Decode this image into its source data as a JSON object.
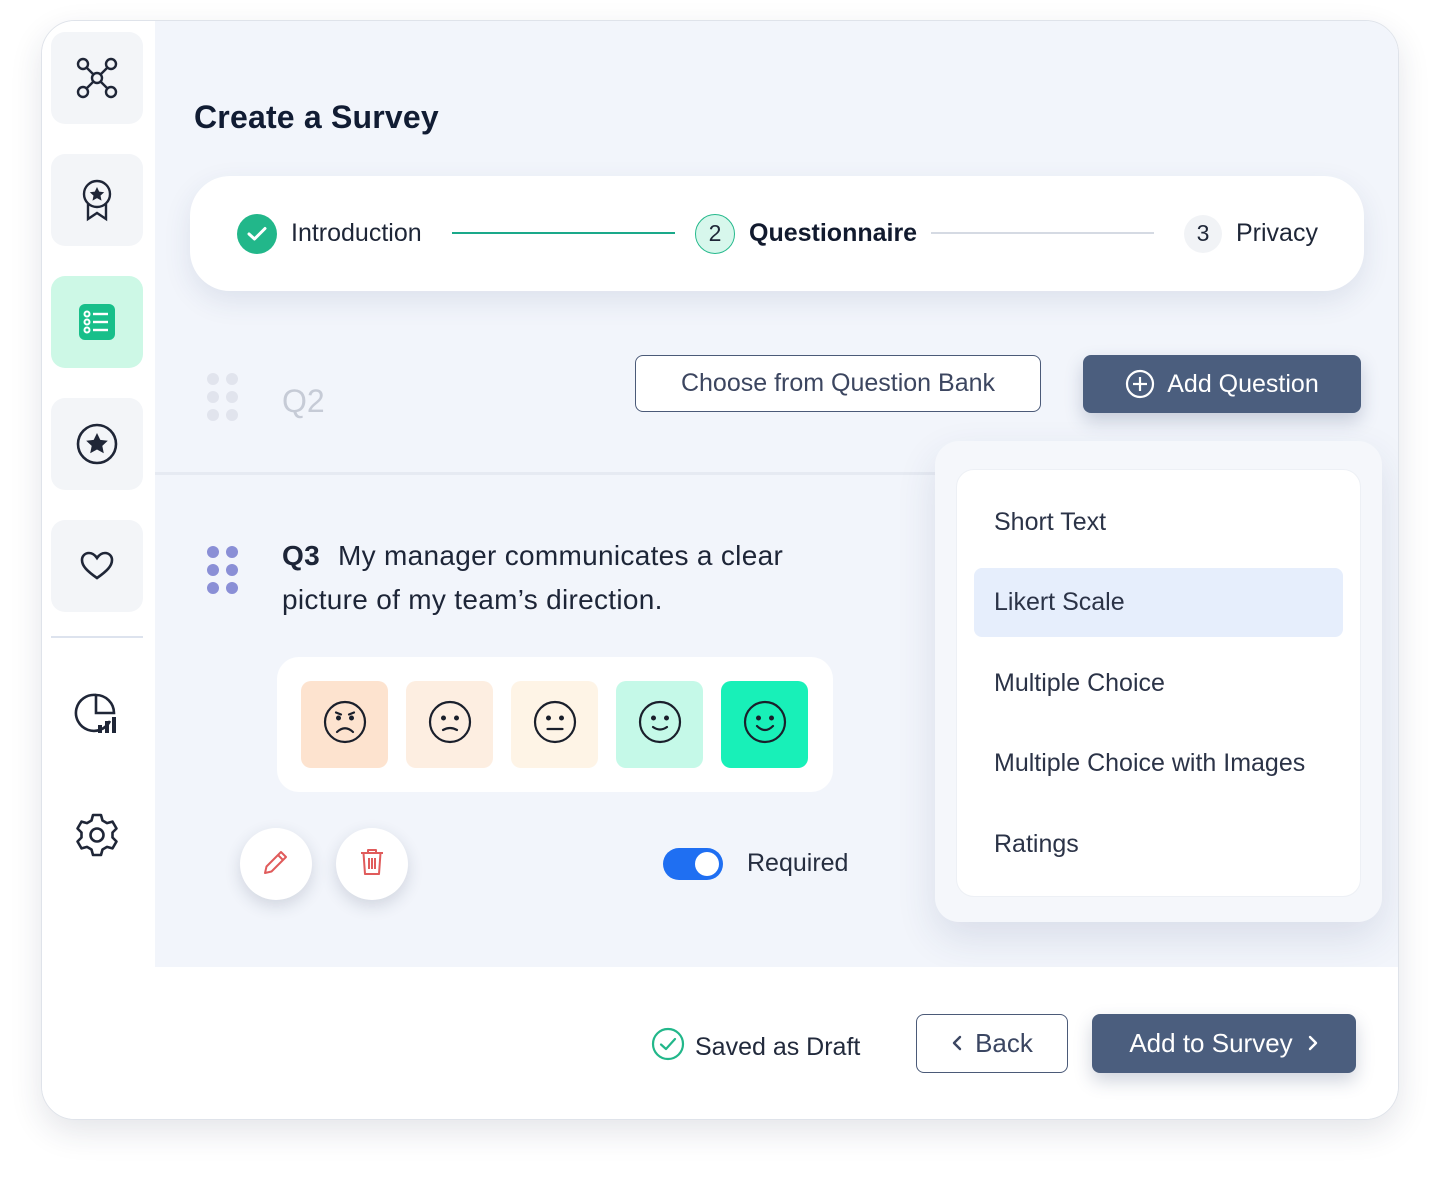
{
  "page": {
    "title": "Create a Survey"
  },
  "sidebar": {
    "items": [
      {
        "name": "network-icon"
      },
      {
        "name": "award-ribbon-icon"
      },
      {
        "name": "survey-list-icon",
        "active": true
      },
      {
        "name": "star-circle-icon"
      },
      {
        "name": "heart-icon"
      },
      {
        "name": "analytics-chart-icon"
      },
      {
        "name": "gear-icon"
      }
    ]
  },
  "stepper": {
    "steps": [
      {
        "number": "",
        "label": "Introduction",
        "status": "completed"
      },
      {
        "number": "2",
        "label": "Questionnaire",
        "status": "current"
      },
      {
        "number": "3",
        "label": "Privacy",
        "status": "pending"
      }
    ]
  },
  "toolbar": {
    "bank_label": "Choose from Question Bank",
    "add_label": "Add Question"
  },
  "questions": {
    "q2": {
      "label": "Q2"
    },
    "q3": {
      "number": "Q3",
      "text": "My manager communicates a clear picture of my team’s direction.",
      "scale": [
        {
          "face": "very-sad-face-icon",
          "color": "#fde3cf"
        },
        {
          "face": "sad-face-icon",
          "color": "#fdeee1"
        },
        {
          "face": "neutral-face-icon",
          "color": "#fef4e6"
        },
        {
          "face": "smile-face-icon",
          "color": "#c5f9e8"
        },
        {
          "face": "happy-face-icon",
          "color": "#18f0b8",
          "selected": true
        }
      ],
      "required_label": "Required",
      "required": true
    }
  },
  "question_types": {
    "items": [
      "Short Text",
      "Likert Scale",
      "Multiple Choice",
      "Multiple Choice with Images",
      "Ratings"
    ],
    "selected": "Likert Scale"
  },
  "footer": {
    "status": "Saved as Draft",
    "back_label": "Back",
    "submit_label": "Add to Survey"
  },
  "colors": {
    "accent": "#4b5e7e",
    "success": "#22b78a",
    "toggle": "#1f6ff2",
    "drag_active": "#8a8fd6"
  }
}
